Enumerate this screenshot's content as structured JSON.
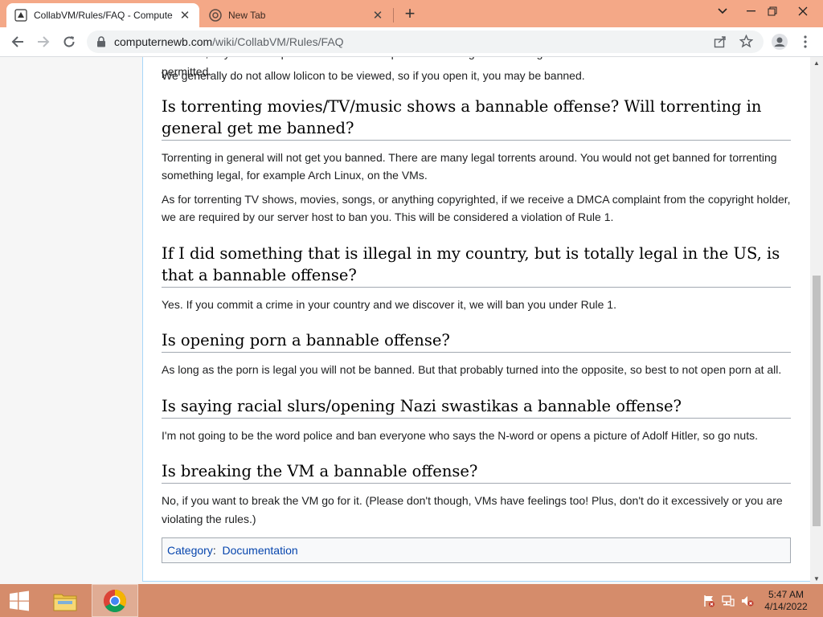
{
  "browser": {
    "tabs": [
      {
        "title": "CollabVM/Rules/FAQ - Compute",
        "active": true
      },
      {
        "title": "New Tab",
        "active": false
      }
    ],
    "url_domain": "computernewb.com",
    "url_path": "/wiki/CollabVM/Rules/FAQ"
  },
  "page": {
    "cut_line": "However, any sexual depictions of minors are prohibited. Things like drawings of children in sexual situations are not permitted.",
    "sections": [
      {
        "id": "lolicon",
        "paragraphs": [
          "We generally do not allow lolicon to be viewed, so if you open it, you may be banned."
        ]
      },
      {
        "heading": "Is torrenting movies/TV/music shows a bannable offense? Will torrenting in general get me banned?",
        "paragraphs": [
          "Torrenting in general will not get you banned. There are many legal torrents around. You would not get banned for torrenting something legal, for example Arch Linux, on the VMs.",
          "As for torrenting TV shows, movies, songs, or anything copyrighted, if we receive a DMCA complaint from the copyright holder, we are required by our server host to ban you. This will be considered a violation of Rule 1."
        ]
      },
      {
        "heading": "If I did something that is illegal in my country, but is totally legal in the US, is that a bannable offense?",
        "paragraphs": [
          "Yes. If you commit a crime in your country and we discover it, we will ban you under Rule 1."
        ]
      },
      {
        "heading": "Is opening porn a bannable offense?",
        "paragraphs": [
          "As long as the porn is legal you will not be banned. But that probably turned into the opposite, so best to not open porn at all."
        ]
      },
      {
        "heading": "Is saying racial slurs/opening Nazi swastikas a bannable offense?",
        "paragraphs": [
          "I'm not going to be the word police and ban everyone who says the N-word or opens a picture of Adolf Hitler, so go nuts."
        ]
      },
      {
        "heading": "Is breaking the VM a bannable offense?",
        "paragraphs": [
          "No, if you want to break the VM go for it. (Please don't though, VMs have feelings too! Plus, don't do it excessively or you are violating the rules.)"
        ]
      }
    ],
    "category_label": "Category",
    "category_link": "Documentation"
  },
  "taskbar": {
    "time": "5:47 AM",
    "date": "4/14/2022"
  },
  "colors": {
    "tabstrip": "#f4a887",
    "taskbar": "#d58c6b",
    "link": "#0645ad"
  }
}
